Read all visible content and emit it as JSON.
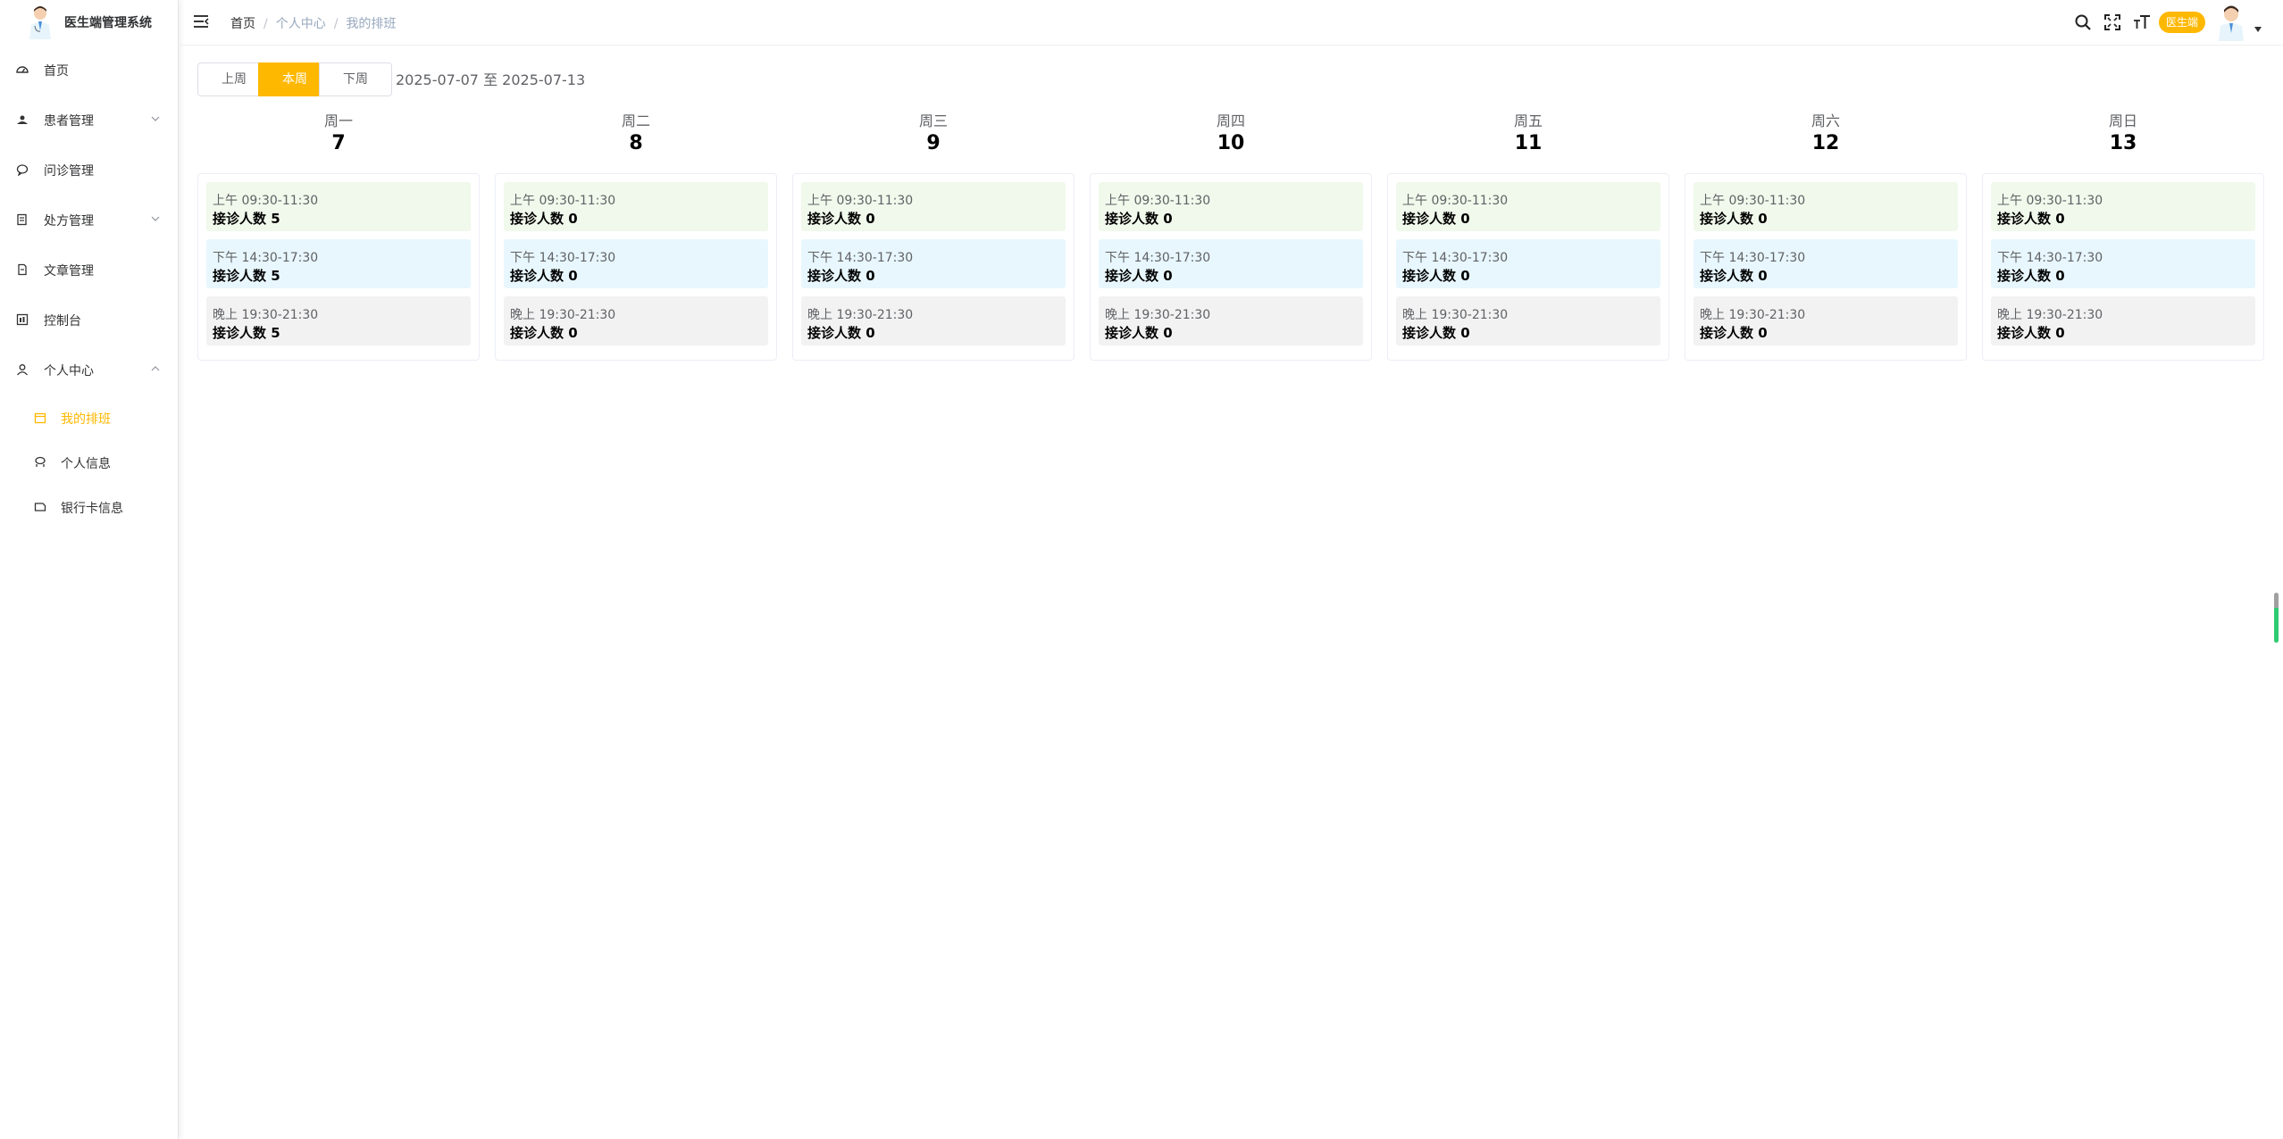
{
  "app": {
    "title": "医生端管理系统"
  },
  "sidebar": {
    "items": [
      {
        "label": "首页",
        "icon": "dashboard-icon"
      },
      {
        "label": "患者管理",
        "icon": "patient-icon"
      },
      {
        "label": "问诊管理",
        "icon": "chat-icon"
      },
      {
        "label": "处方管理",
        "icon": "prescription-icon"
      },
      {
        "label": "文章管理",
        "icon": "article-icon"
      },
      {
        "label": "控制台",
        "icon": "console-icon"
      },
      {
        "label": "个人中心",
        "icon": "user-icon"
      }
    ],
    "sub_items": [
      {
        "label": "我的排班",
        "icon": "calendar-icon",
        "active": true
      },
      {
        "label": "个人信息",
        "icon": "profile-icon"
      },
      {
        "label": "银行卡信息",
        "icon": "bankcard-icon"
      }
    ]
  },
  "header": {
    "breadcrumb": [
      "首页",
      "个人中心",
      "我的排班"
    ],
    "role_badge": "医生端"
  },
  "week_nav": {
    "prev": "上周",
    "current": "本周",
    "next": "下周",
    "range": "2025-07-07 至 2025-07-13"
  },
  "days": [
    {
      "name": "周一",
      "date": "7",
      "slots": [
        {
          "time": "上午 09:30-11:30",
          "count": "接诊人数 5"
        },
        {
          "time": "下午 14:30-17:30",
          "count": "接诊人数 5"
        },
        {
          "time": "晚上 19:30-21:30",
          "count": "接诊人数 5"
        }
      ]
    },
    {
      "name": "周二",
      "date": "8",
      "slots": [
        {
          "time": "上午 09:30-11:30",
          "count": "接诊人数 0"
        },
        {
          "time": "下午 14:30-17:30",
          "count": "接诊人数 0"
        },
        {
          "time": "晚上 19:30-21:30",
          "count": "接诊人数 0"
        }
      ]
    },
    {
      "name": "周三",
      "date": "9",
      "slots": [
        {
          "time": "上午 09:30-11:30",
          "count": "接诊人数 0"
        },
        {
          "time": "下午 14:30-17:30",
          "count": "接诊人数 0"
        },
        {
          "time": "晚上 19:30-21:30",
          "count": "接诊人数 0"
        }
      ]
    },
    {
      "name": "周四",
      "date": "10",
      "slots": [
        {
          "time": "上午 09:30-11:30",
          "count": "接诊人数 0"
        },
        {
          "time": "下午 14:30-17:30",
          "count": "接诊人数 0"
        },
        {
          "time": "晚上 19:30-21:30",
          "count": "接诊人数 0"
        }
      ]
    },
    {
      "name": "周五",
      "date": "11",
      "slots": [
        {
          "time": "上午 09:30-11:30",
          "count": "接诊人数 0"
        },
        {
          "time": "下午 14:30-17:30",
          "count": "接诊人数 0"
        },
        {
          "time": "晚上 19:30-21:30",
          "count": "接诊人数 0"
        }
      ]
    },
    {
      "name": "周六",
      "date": "12",
      "slots": [
        {
          "time": "上午 09:30-11:30",
          "count": "接诊人数 0"
        },
        {
          "time": "下午 14:30-17:30",
          "count": "接诊人数 0"
        },
        {
          "time": "晚上 19:30-21:30",
          "count": "接诊人数 0"
        }
      ]
    },
    {
      "name": "周日",
      "date": "13",
      "slots": [
        {
          "time": "上午 09:30-11:30",
          "count": "接诊人数 0"
        },
        {
          "time": "下午 14:30-17:30",
          "count": "接诊人数 0"
        },
        {
          "time": "晚上 19:30-21:30",
          "count": "接诊人数 0"
        }
      ]
    }
  ],
  "colors": {
    "accent": "#ffb800",
    "morning_bg": "#f0f9eb",
    "afternoon_bg": "#e8f7fd",
    "evening_bg": "#f2f2f2"
  }
}
